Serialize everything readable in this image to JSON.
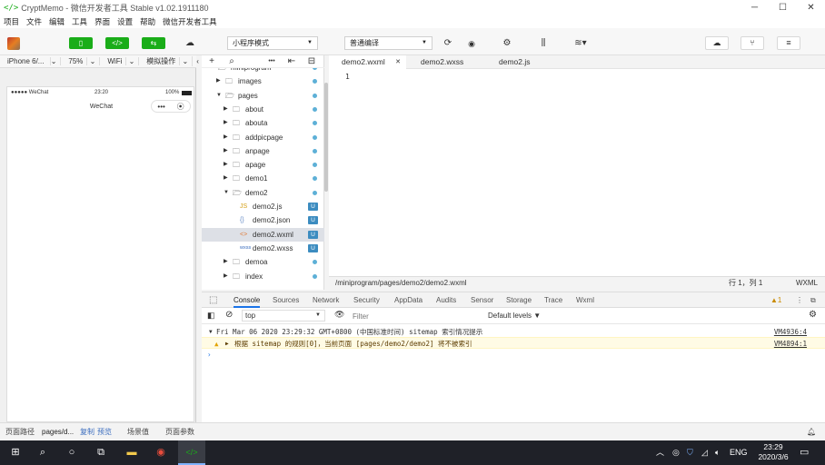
{
  "window": {
    "title": "CryptMemo - 微信开发者工具 Stable v1.02.1911180",
    "controls": {
      "minimize": "─",
      "maximize": "☐",
      "close": "✕"
    }
  },
  "menu": [
    "项目",
    "文件",
    "编辑",
    "工具",
    "界面",
    "设置",
    "帮助",
    "微信开发者工具"
  ],
  "toolbar": {
    "simulator_btn": "▯",
    "editor_btn": "</>",
    "debugger_btn": "⇆",
    "mode_select": "小程序模式",
    "compile_select": "普通编译",
    "refresh_icon": "⟳",
    "preview_icon": "👁",
    "debug_icon": "⚙",
    "layout_icon": "⫼",
    "stack_icon": "≋",
    "upload_icon": "☁",
    "version_icon": "⑂",
    "details_icon": "≡"
  },
  "device_bar": {
    "device": "iPhone 6/... ",
    "zoom": "75%",
    "network": "WiFi",
    "operation": "模拟操作",
    "collapse": "‹"
  },
  "phone": {
    "carrier": "●●●●● WeChat",
    "time": "23:20",
    "battery": "100%",
    "nav_title": "WeChat",
    "capsule_menu": "•••",
    "capsule_close": "⦿"
  },
  "tree_toolbar": {
    "add": "+",
    "search": "⌕",
    "more": "•••",
    "outline": "⇤",
    "collapse": "⊟"
  },
  "tree": [
    {
      "label": "miniprogram",
      "type": "folder",
      "open": true,
      "depth": 0,
      "mark": "dot"
    },
    {
      "label": "images",
      "type": "folder",
      "open": false,
      "depth": 1,
      "mark": "dot"
    },
    {
      "label": "pages",
      "type": "folder",
      "open": true,
      "depth": 1,
      "mark": "dot"
    },
    {
      "label": "about",
      "type": "folder",
      "open": false,
      "depth": 2,
      "mark": "dot"
    },
    {
      "label": "abouta",
      "type": "folder",
      "open": false,
      "depth": 2,
      "mark": "dot"
    },
    {
      "label": "addpicpage",
      "type": "folder",
      "open": false,
      "depth": 2,
      "mark": "dot"
    },
    {
      "label": "anpage",
      "type": "folder",
      "open": false,
      "depth": 2,
      "mark": "dot"
    },
    {
      "label": "apage",
      "type": "folder",
      "open": false,
      "depth": 2,
      "mark": "dot"
    },
    {
      "label": "demo1",
      "type": "folder",
      "open": false,
      "depth": 2,
      "mark": "dot"
    },
    {
      "label": "demo2",
      "type": "folder",
      "open": true,
      "depth": 2,
      "mark": "dot"
    },
    {
      "label": "demo2.js",
      "type": "js",
      "depth": 3,
      "mark": "U"
    },
    {
      "label": "demo2.json",
      "type": "json",
      "depth": 3,
      "mark": "U"
    },
    {
      "label": "demo2.wxml",
      "type": "wxml",
      "depth": 3,
      "mark": "U",
      "selected": true
    },
    {
      "label": "demo2.wxss",
      "type": "wxss",
      "depth": 3,
      "mark": "U"
    },
    {
      "label": "demoa",
      "type": "folder",
      "open": false,
      "depth": 2,
      "mark": "dot"
    },
    {
      "label": "index",
      "type": "folder",
      "open": false,
      "depth": 2,
      "mark": "dot"
    }
  ],
  "editor": {
    "tabs": [
      {
        "label": "demo2.wxml",
        "active": true,
        "close": "✕"
      },
      {
        "label": "demo2.wxss",
        "active": false
      },
      {
        "label": "demo2.js",
        "active": false
      }
    ],
    "line_numbers": [
      "1"
    ],
    "status_path": "/miniprogram/pages/demo2/demo2.wxml",
    "status_pos": "行 1，列 1",
    "status_lang": "WXML"
  },
  "devtools": {
    "tabs": [
      "Console",
      "Sources",
      "Network",
      "Security",
      "AppData",
      "Audits",
      "Sensor",
      "Storage",
      "Trace",
      "Wxml"
    ],
    "warning_count": "1",
    "context": "top",
    "filter_placeholder": "Filter",
    "levels": "Default levels ▼",
    "lines": [
      {
        "text": "Fri Mar 06 2020 23:29:32 GMT+0800 (中国标准时间) sitemap 索引情况提示",
        "src": "VM4936:4",
        "level": "info"
      },
      {
        "text": "根据 sitemap 的规则[0]，当前页面 [pages/demo2/demo2] 将不被索引",
        "src": "VM4894:1",
        "level": "warning"
      }
    ],
    "prompt": "›"
  },
  "bottom_bar": {
    "path_label": "页面路径",
    "path_value": "pages/d...",
    "copy": "复制",
    "preview": "预览",
    "scene": "场景值",
    "params": "页面参数"
  },
  "taskbar": {
    "lang": "ENG",
    "time": "23:29",
    "date": "2020/3/6"
  },
  "colors": {
    "accent_green": "#1aad19",
    "badge_blue": "#3c8cc0",
    "taskbar": "#1f2128"
  }
}
